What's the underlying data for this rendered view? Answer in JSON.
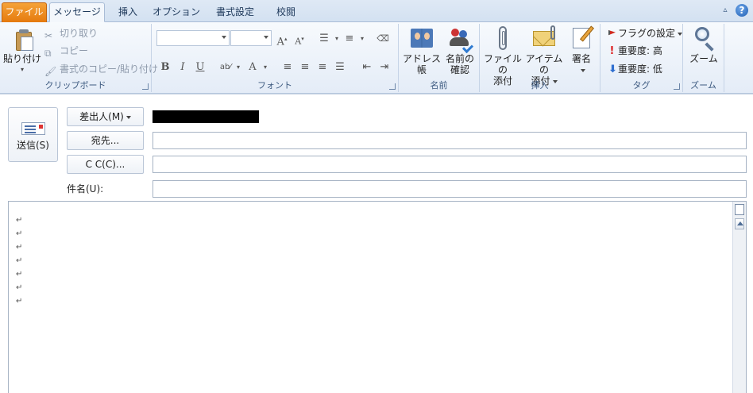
{
  "tabs": {
    "file": "ファイル",
    "message": "メッセージ",
    "insert": "挿入",
    "options": "オプション",
    "format": "書式設定",
    "review": "校閲"
  },
  "clipboard": {
    "paste": "貼り付け",
    "cut": "切り取り",
    "copy": "コピー",
    "format_painter": "書式のコピー/貼り付け",
    "label": "クリップボード"
  },
  "font": {
    "label": "フォント",
    "family_value": "",
    "size_value": ""
  },
  "names": {
    "address_book": "アドレス帳",
    "check_names_l1": "名前の",
    "check_names_l2": "確認",
    "label": "名前"
  },
  "include": {
    "attach_file_l1": "ファイルの",
    "attach_file_l2": "添付",
    "attach_item_l1": "アイテムの",
    "attach_item_l2": "添付",
    "signature": "署名",
    "label": "挿入"
  },
  "tags": {
    "follow_up": "フラグの設定",
    "high_importance": "重要度: 高",
    "low_importance": "重要度: 低",
    "label": "タグ"
  },
  "zoom": {
    "zoom": "ズーム",
    "label": "ズーム"
  },
  "form": {
    "send": "送信(S)",
    "from": "差出人(M)",
    "to": "宛先...",
    "cc": "C C(C)...",
    "subject_label": "件名(U):",
    "to_value": "",
    "cc_value": "",
    "subject_value": ""
  },
  "body": {
    "paragraph_mark": "↵"
  },
  "colors": {
    "file_tab": "#e57a0e",
    "ribbon_bg": "#e4ecf7",
    "redaction": "#000000"
  }
}
